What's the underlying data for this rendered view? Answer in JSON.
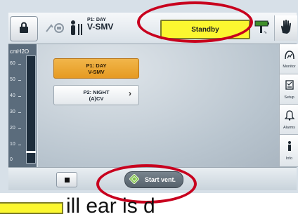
{
  "topbar": {
    "profile_label": "P1: DAY",
    "mode_label": "V-SMV",
    "status_text": "Standby"
  },
  "gauge": {
    "unit": "cmH2O",
    "ticks": [
      "60",
      "50",
      "40",
      "30",
      "20",
      "10",
      "0"
    ],
    "level_value": 5
  },
  "main": {
    "profile1": {
      "line1": "P1: DAY",
      "line2": "V-SMV"
    },
    "profile2": {
      "line1": "P2: NIGHT",
      "line2": "(A)CV"
    }
  },
  "sidebar": {
    "items": [
      {
        "label": "Monitor",
        "icon": "monitor-icon"
      },
      {
        "label": "Setup",
        "icon": "setup-icon"
      },
      {
        "label": "Alarms",
        "icon": "bell-icon"
      },
      {
        "label": "Info",
        "icon": "info-icon"
      }
    ]
  },
  "bottombar": {
    "start_label": "Start vent."
  },
  "caption": {
    "text": "ill     ear is   d  "
  },
  "colors": {
    "standby_yellow": "#fbf730",
    "active_profile": "#e69a22",
    "annotation_red": "#c8001e"
  }
}
